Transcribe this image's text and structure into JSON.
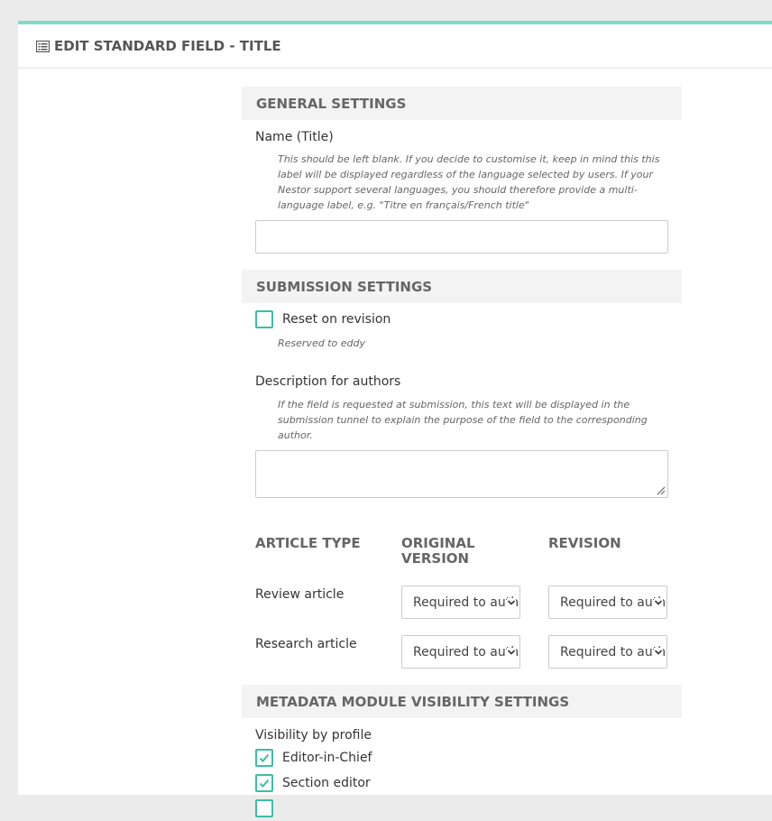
{
  "header": {
    "title": "EDIT STANDARD FIELD - TITLE"
  },
  "general": {
    "title": "GENERAL SETTINGS",
    "name_label": "Name (Title)",
    "name_help": "This should be left blank. If you decide to customise it, keep in mind this this label will be displayed regardless of the language selected by users. If your Nestor support several languages, you should therefore provide a multi-language label, e.g. \"Titre en français/French title\"",
    "name_value": ""
  },
  "submission": {
    "title": "SUBMISSION SETTINGS",
    "reset_label": "Reset on revision",
    "reset_checked": false,
    "reset_help": "Reserved to eddy",
    "desc_label": "Description for authors",
    "desc_help": "If the field is requested at submission, this text will be displayed in the submission tunnel to explain the purpose of the field to the corresponding author.",
    "desc_value": ""
  },
  "article_table": {
    "headers": [
      "ARTICLE TYPE",
      "ORIGINAL VERSION",
      "REVISION"
    ],
    "rows": [
      {
        "type": "Review article",
        "original": "Required to author",
        "revision": "Required to author"
      },
      {
        "type": "Research article",
        "original": "Required to author",
        "revision": "Required to author"
      }
    ]
  },
  "metadata": {
    "title": "METADATA MODULE VISIBILITY SETTINGS",
    "visibility_label": "Visibility by profile",
    "profiles": [
      {
        "label": "Editor-in-Chief",
        "checked": true
      },
      {
        "label": "Section editor",
        "checked": true
      }
    ]
  },
  "colors": {
    "accent": "#3bbfa4",
    "top_border": "#7fdcc9",
    "section_bg": "#f3f3f3"
  }
}
